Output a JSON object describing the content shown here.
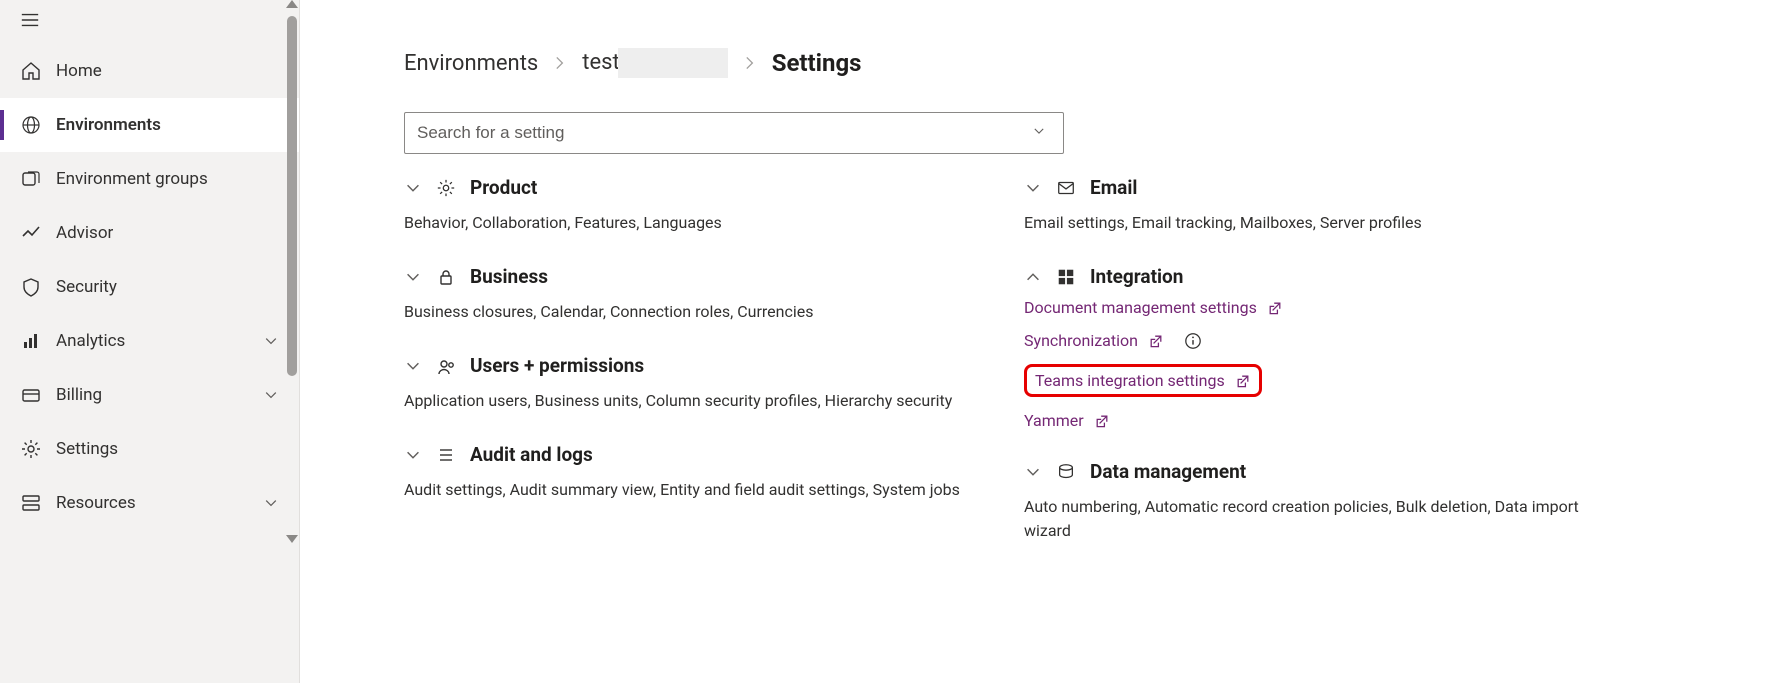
{
  "sidebar": {
    "items": [
      {
        "label": "Home",
        "expandable": false
      },
      {
        "label": "Environments",
        "expandable": false
      },
      {
        "label": "Environment groups",
        "expandable": false
      },
      {
        "label": "Advisor",
        "expandable": false
      },
      {
        "label": "Security",
        "expandable": false
      },
      {
        "label": "Analytics",
        "expandable": true
      },
      {
        "label": "Billing",
        "expandable": true
      },
      {
        "label": "Settings",
        "expandable": false
      },
      {
        "label": "Resources",
        "expandable": true
      }
    ],
    "active_index": 1
  },
  "breadcrumb": {
    "root": "Environments",
    "env_prefix": "test",
    "env_redacted": true,
    "current": "Settings"
  },
  "search": {
    "placeholder": "Search for a setting"
  },
  "left_groups": [
    {
      "title": "Product",
      "desc": "Behavior, Collaboration, Features, Languages",
      "expanded": false
    },
    {
      "title": "Business",
      "desc": "Business closures, Calendar, Connection roles, Currencies",
      "expanded": false
    },
    {
      "title": "Users + permissions",
      "desc": "Application users, Business units, Column security profiles, Hierarchy security",
      "expanded": false
    },
    {
      "title": "Audit and logs",
      "desc": "Audit settings, Audit summary view, Entity and field audit settings, System jobs",
      "expanded": false
    }
  ],
  "right_groups": {
    "email": {
      "title": "Email",
      "desc": "Email settings, Email tracking, Mailboxes, Server profiles",
      "expanded": false
    },
    "integration": {
      "title": "Integration",
      "expanded": true,
      "links": [
        {
          "label": "Document management settings",
          "ext": true,
          "info": false,
          "highlight": false
        },
        {
          "label": "Synchronization",
          "ext": true,
          "info": true,
          "highlight": false
        },
        {
          "label": "Teams integration settings",
          "ext": true,
          "info": false,
          "highlight": true
        },
        {
          "label": "Yammer",
          "ext": true,
          "info": false,
          "highlight": false
        }
      ]
    },
    "data_mgmt": {
      "title": "Data management",
      "desc": "Auto numbering, Automatic record creation policies, Bulk deletion, Data import wizard",
      "expanded": false
    }
  }
}
